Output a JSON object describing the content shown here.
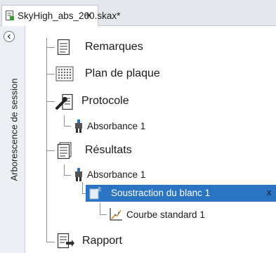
{
  "tab": {
    "title": "SkyHigh_abs_260.skax*",
    "close": "×"
  },
  "rail": {
    "label": "Arborescence de session"
  },
  "tree": {
    "remarques": "Remarques",
    "plan": "Plan de plaque",
    "protocole": "Protocole",
    "protocole_abs": "Absorbance 1",
    "resultats": "Résultats",
    "resultats_abs": "Absorbance 1",
    "soustraction": "Soustraction du blanc 1",
    "soustraction_close": "x",
    "courbe": "Courbe standard 1",
    "rapport": "Rapport"
  },
  "colors": {
    "selection": "#2b74c4",
    "tab_bar": "#e4e7ec",
    "rail": "#eceff3"
  },
  "icons": [
    "document-icon",
    "collapse-icon",
    "notes-icon",
    "plate-grid-icon",
    "protocol-wrench-icon",
    "absorbance-icon",
    "results-icon",
    "blank-subtraction-icon",
    "standard-curve-icon",
    "report-icon"
  ]
}
